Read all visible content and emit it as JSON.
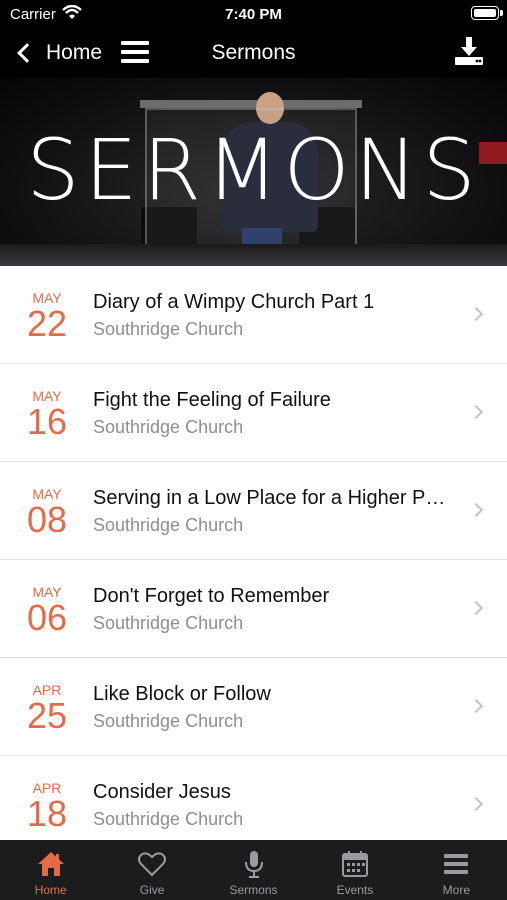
{
  "status_bar": {
    "carrier": "Carrier",
    "time": "7:40 PM"
  },
  "nav": {
    "back_label": "Home",
    "title": "Sermons"
  },
  "hero": {
    "title": "SERMONS"
  },
  "sermons": [
    {
      "month": "MAY",
      "day": "22",
      "title": "Diary of a Wimpy Church Part 1",
      "subtitle": "Southridge Church"
    },
    {
      "month": "MAY",
      "day": "16",
      "title": "Fight the Feeling of Failure",
      "subtitle": "Southridge Church"
    },
    {
      "month": "MAY",
      "day": "08",
      "title": "Serving in a Low Place for a Higher P…",
      "subtitle": "Southridge Church"
    },
    {
      "month": "MAY",
      "day": "06",
      "title": "Don't Forget to Remember",
      "subtitle": "Southridge Church"
    },
    {
      "month": "APR",
      "day": "25",
      "title": "Like Block or Follow",
      "subtitle": "Southridge Church"
    },
    {
      "month": "APR",
      "day": "18",
      "title": "Consider Jesus",
      "subtitle": "Southridge Church"
    }
  ],
  "tabs": [
    {
      "label": "Home",
      "icon": "home-icon",
      "active": true
    },
    {
      "label": "Give",
      "icon": "heart-icon",
      "active": false
    },
    {
      "label": "Sermons",
      "icon": "microphone-icon",
      "active": false
    },
    {
      "label": "Events",
      "icon": "calendar-icon",
      "active": false
    },
    {
      "label": "More",
      "icon": "menu-icon",
      "active": false
    }
  ],
  "colors": {
    "accent": "#e56a48",
    "tab_inactive": "#9a9a9f",
    "tab_bar_bg": "#1c1c1e"
  }
}
